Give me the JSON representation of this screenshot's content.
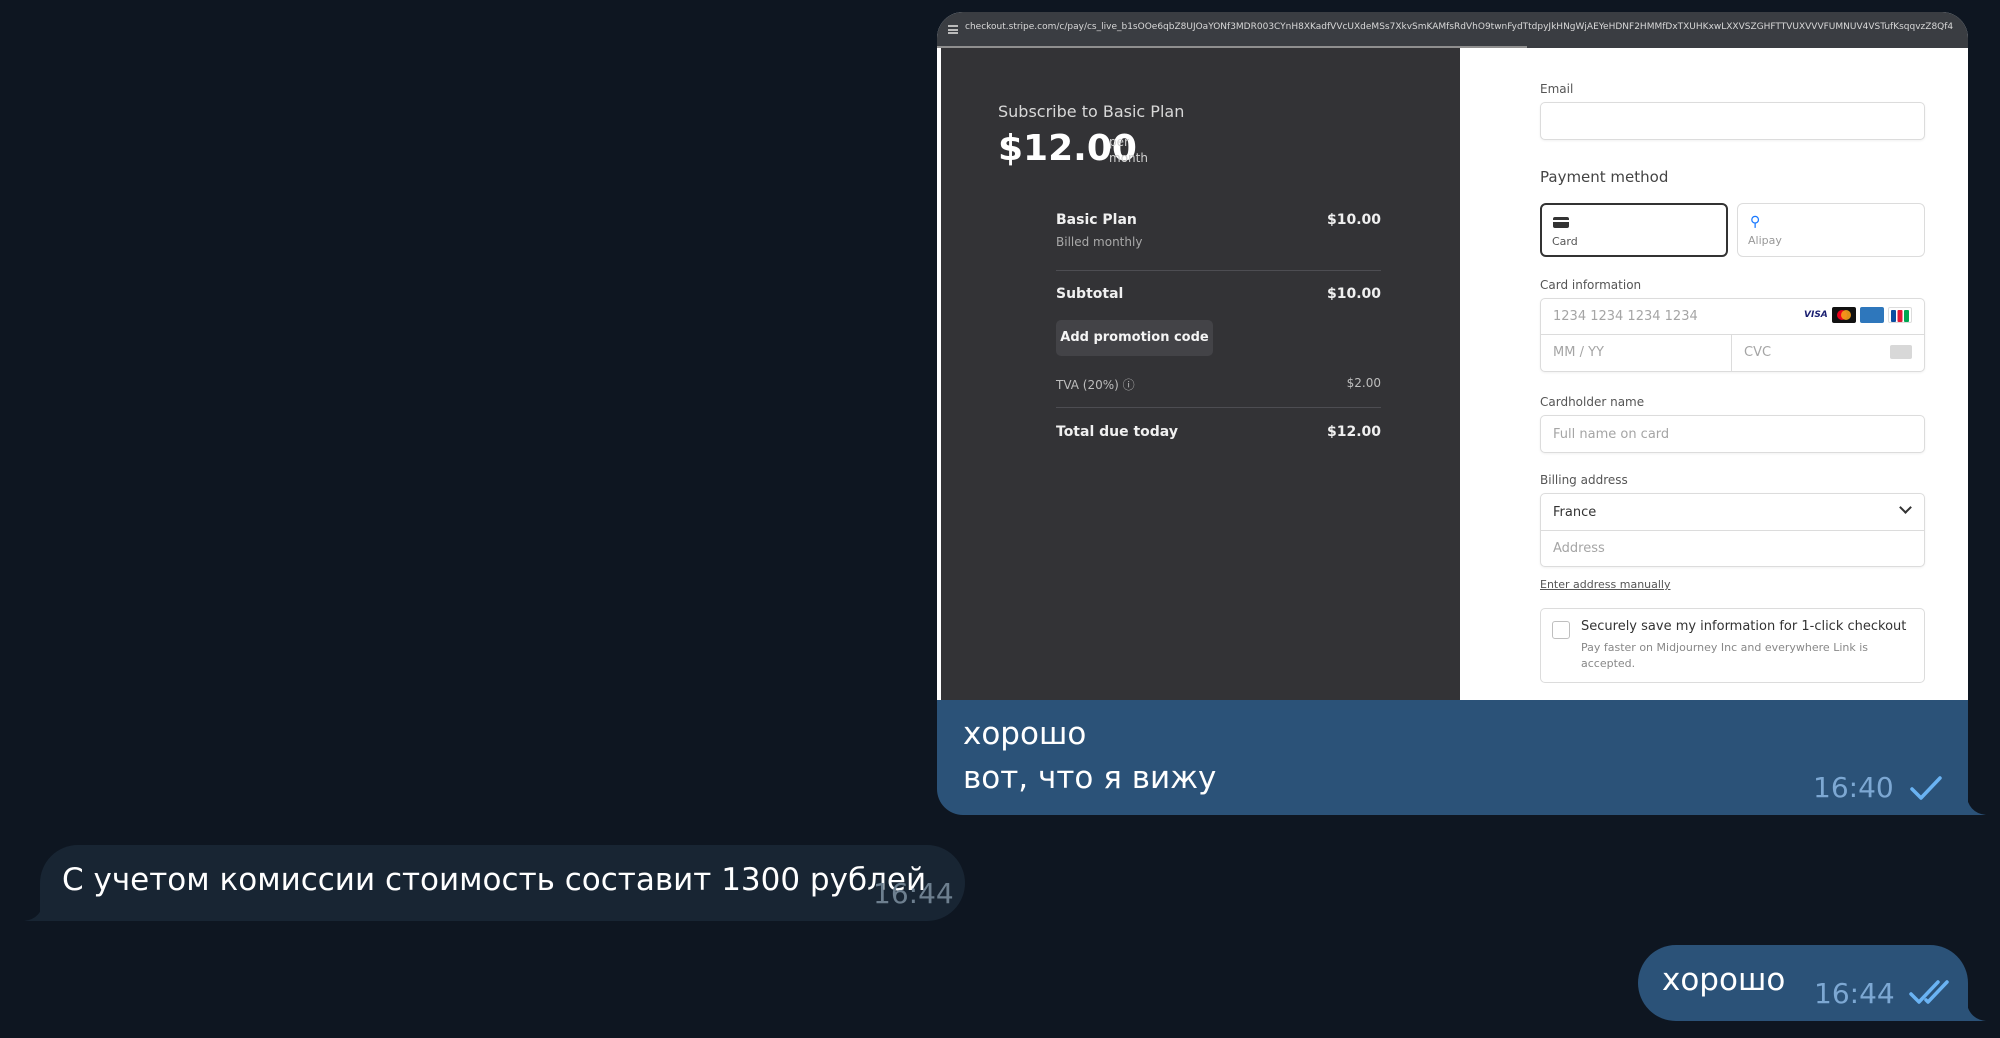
{
  "messages": [
    {
      "direction": "outgoing",
      "text_lines": [
        "хорошо",
        "вот, что я вижу"
      ],
      "time": "16:40",
      "status": "sent"
    },
    {
      "direction": "incoming",
      "text": "С учетом комиссии стоимость составит 1300 рублей",
      "time": "16:44"
    },
    {
      "direction": "outgoing",
      "text": "хорошо",
      "time": "16:44",
      "status": "read"
    }
  ],
  "attachment": {
    "url": "checkout.stripe.com/c/pay/cs_live_b1sOOe6qbZ8UJOaYONf3MDR003CYnH8XKadfVVcUXdeMSs7XkvSmKAMfsRdVhO9twnFydTtdpyJkHNgWjAEYeHDNF2HMMfDxTXUHKxwLXXVSZGHFTTVUXVVVFUMNUV4VSTufKsqqvzZ8Qf4",
    "order_summary": {
      "title": "Subscribe to Basic Plan",
      "price": "$12.00",
      "per": "per",
      "period": "month",
      "items": [
        {
          "name": "Basic Plan",
          "sub": "Billed monthly",
          "amount": "$10.00"
        }
      ],
      "subtotal_label": "Subtotal",
      "subtotal_amount": "$10.00",
      "promo_button": "Add promotion code",
      "tax_label": "TVA (20%) ⓘ",
      "tax_amount": "$2.00",
      "total_label": "Total due today",
      "total_amount": "$12.00"
    },
    "payment_form": {
      "email_label": "Email",
      "email_value": "",
      "method_heading": "Payment method",
      "methods": [
        "Card",
        "Alipay"
      ],
      "selected_method": "Card",
      "card_info_label": "Card information",
      "card_number_placeholder": "1234 1234 1234 1234",
      "expiry_placeholder": "MM / YY",
      "cvc_placeholder": "CVC",
      "card_brands": [
        "visa-icon",
        "mastercard-icon",
        "amex-icon",
        "jcb-icon"
      ],
      "cardholder_label": "Cardholder name",
      "cardholder_placeholder": "Full name on card",
      "billing_label": "Billing address",
      "country": "France",
      "address_placeholder": "Address",
      "manual_link": "Enter address manually",
      "save_title": "Securely save my information for 1-click checkout",
      "save_desc": "Pay faster on Midjourney Inc and everywhere Link is accepted."
    }
  },
  "colors": {
    "background": "#0e1621",
    "outgoing_bubble": "#2b5278",
    "incoming_bubble": "#182533",
    "check": "#6ab3f3"
  }
}
